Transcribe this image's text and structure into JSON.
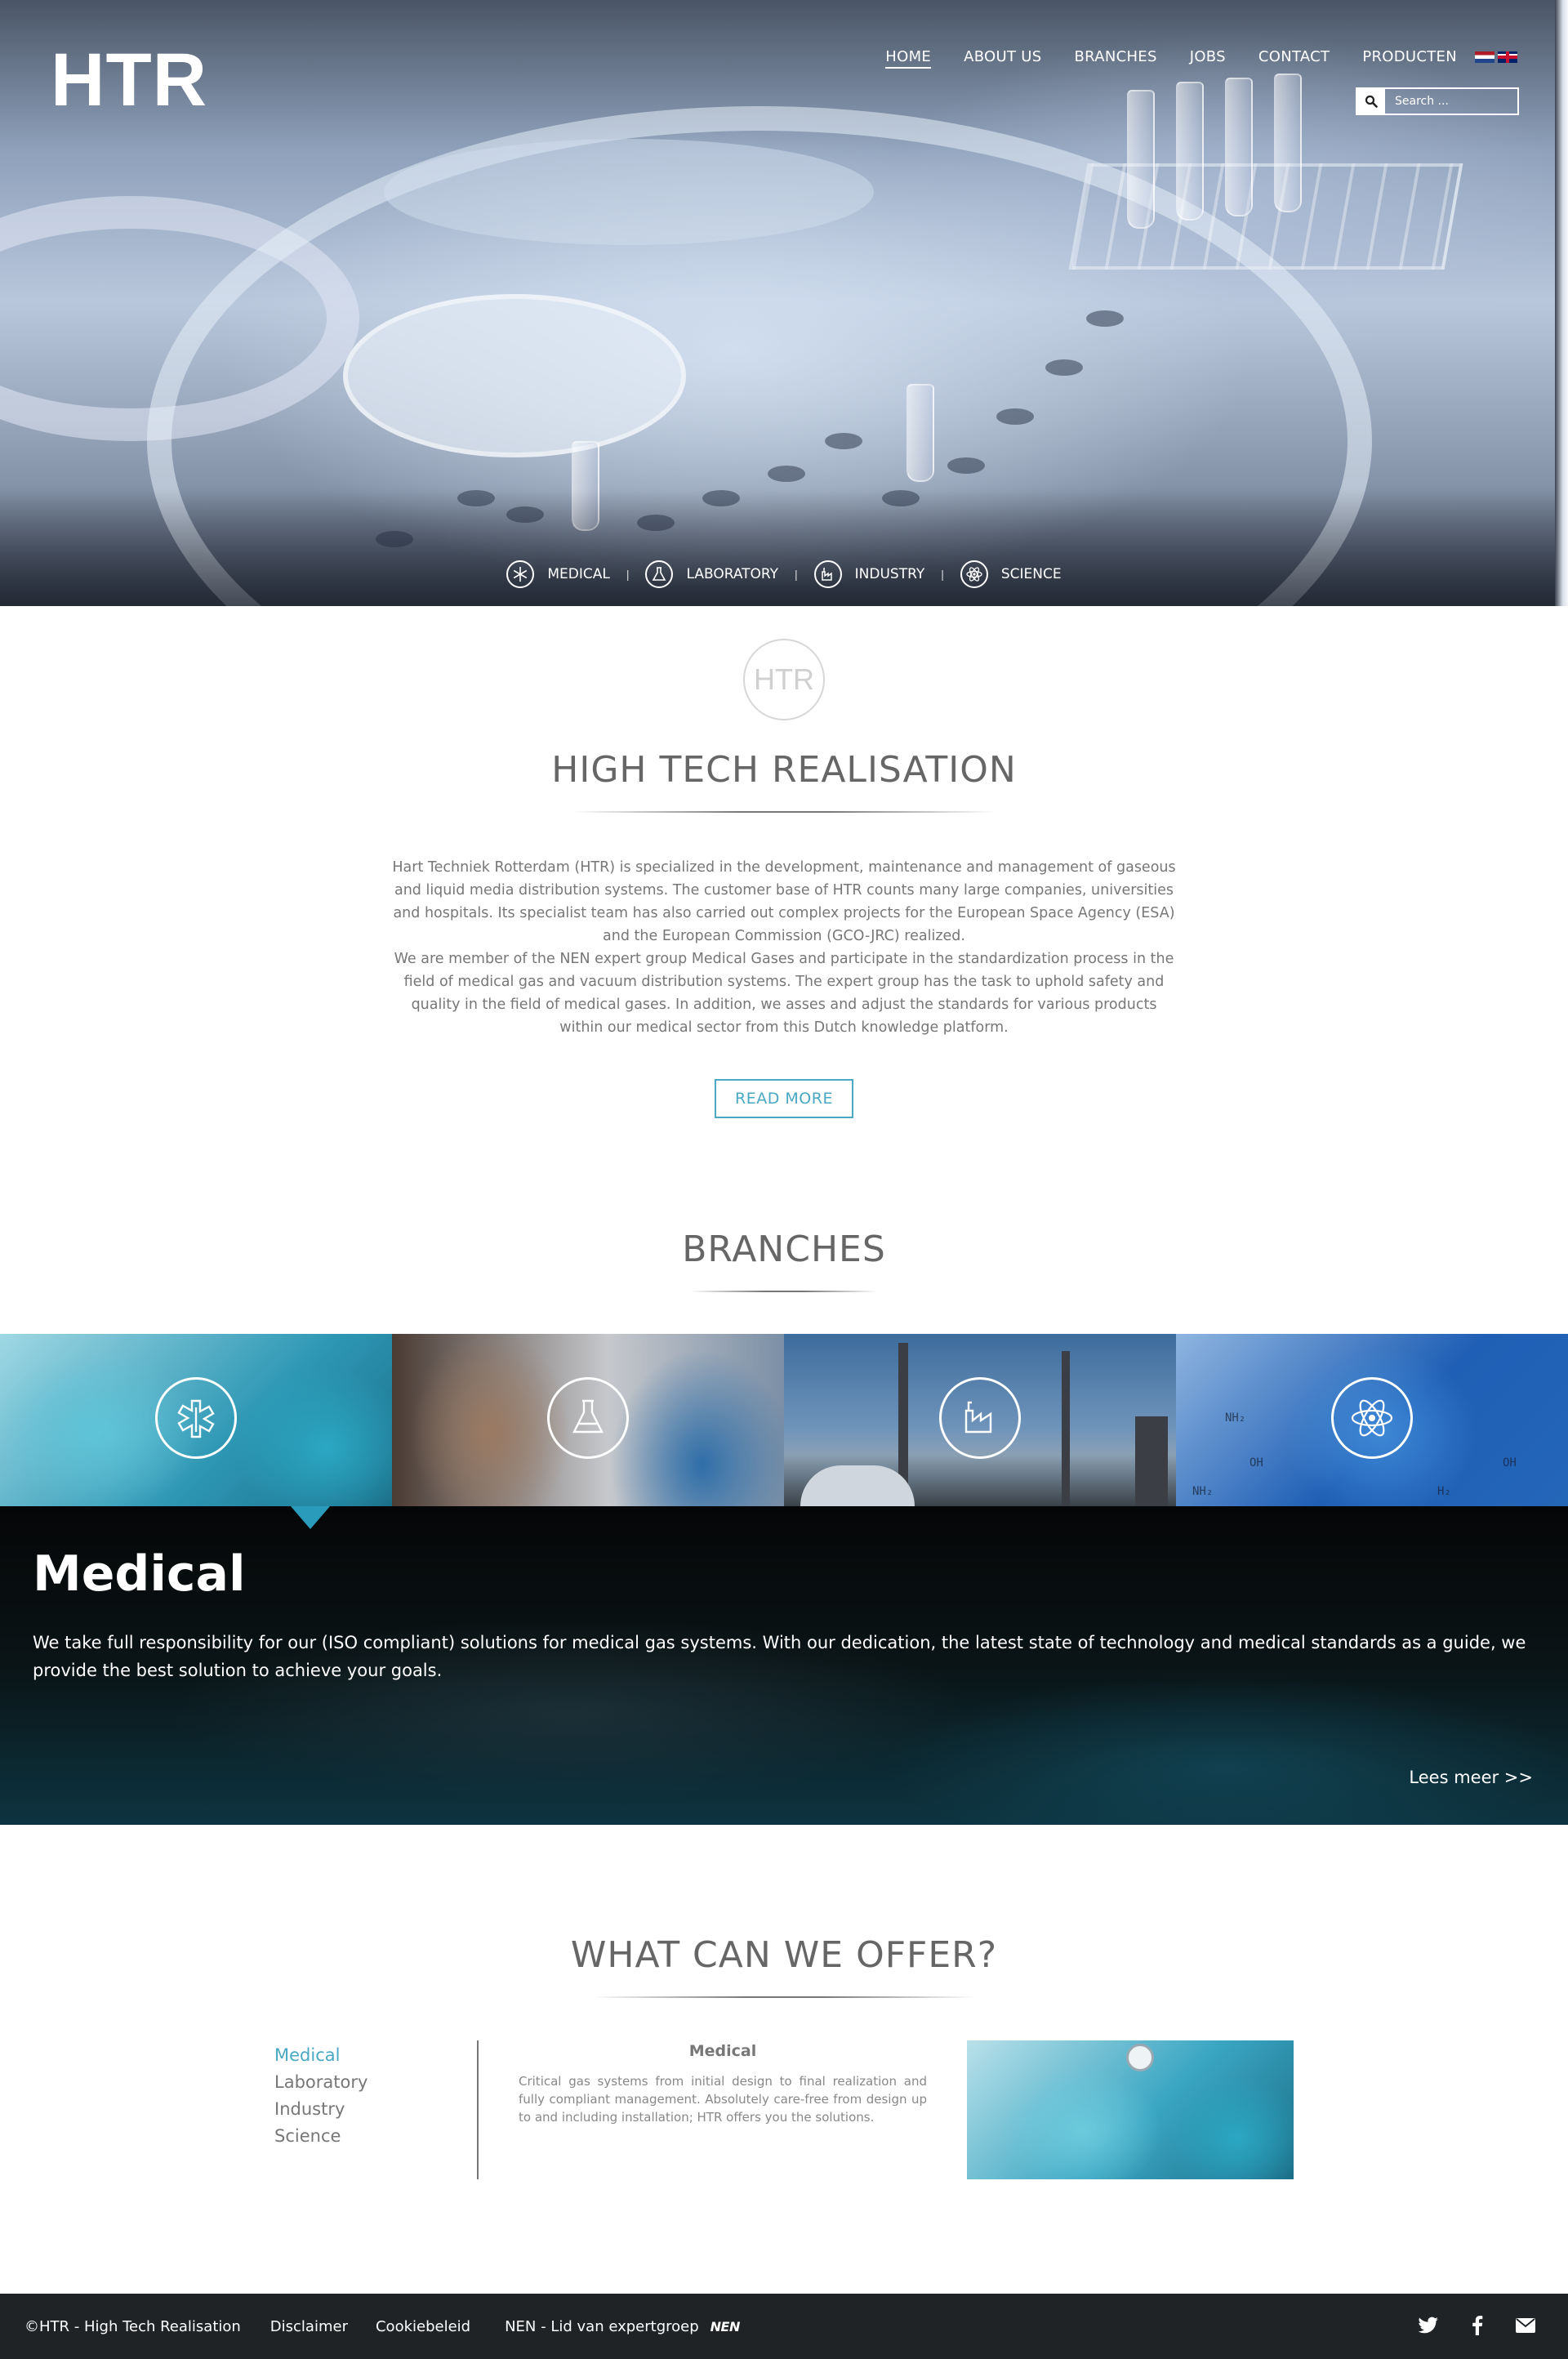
{
  "header": {
    "logo": "HTR",
    "nav": [
      "HOME",
      "ABOUT US",
      "BRANCHES",
      "JOBS",
      "CONTACT",
      "PRODUCTEN"
    ],
    "search_placeholder": "Search ..."
  },
  "hero": {
    "branches": [
      "MEDICAL",
      "LABORATORY",
      "INDUSTRY",
      "SCIENCE"
    ]
  },
  "intro": {
    "badge": "HTR",
    "title": "HIGH TECH REALISATION",
    "paragraph1": "Hart Techniek Rotterdam (HTR) is specialized in the development, maintenance and management of gaseous and liquid media distribution systems. The customer base of HTR counts many large companies, universities and hospitals. Its specialist team has also carried out complex projects for the European Space Agency (ESA) and the European Commission (GCO-JRC) realized.",
    "paragraph2": "We are member of the NEN expert group Medical Gases and participate in the standardization process in the field of medical gas and vacuum distribution systems. The expert group has the task to uphold safety and quality in the field of medical gases. In addition, we asses and adjust the standards for various products within our medical sector from this Dutch knowledge platform.",
    "read_more": "READ MORE"
  },
  "branches": {
    "title": "BRANCHES",
    "active": {
      "title": "Medical",
      "text": "We take full responsibility for our (ISO compliant) solutions for medical gas systems. With our dedication, the latest state of technology and medical standards as a guide, we provide the best solution to achieve your goals.",
      "link": "Lees meer >>"
    },
    "science_text": [
      "NH₂",
      "OH",
      "NH₂",
      "OH",
      "H₂"
    ]
  },
  "offer": {
    "title": "WHAT CAN WE OFFER?",
    "items": [
      "Medical",
      "Laboratory",
      "Industry",
      "Science"
    ],
    "active_title": "Medical",
    "active_text": "Critical gas systems from initial design to final realization and fully compliant management. Absolutely care-free from design up to and including installation; HTR offers you the solutions."
  },
  "footer": {
    "copyright": "©HTR - High Tech Realisation",
    "disclaimer": "Disclaimer",
    "cookie": "Cookiebeleid",
    "nen": "NEN - Lid van expertgroep",
    "nen_logo": "NEN"
  },
  "colors": {
    "accent": "#4aa8c4",
    "footer_bg": "#1f2326",
    "heading": "#666666"
  }
}
